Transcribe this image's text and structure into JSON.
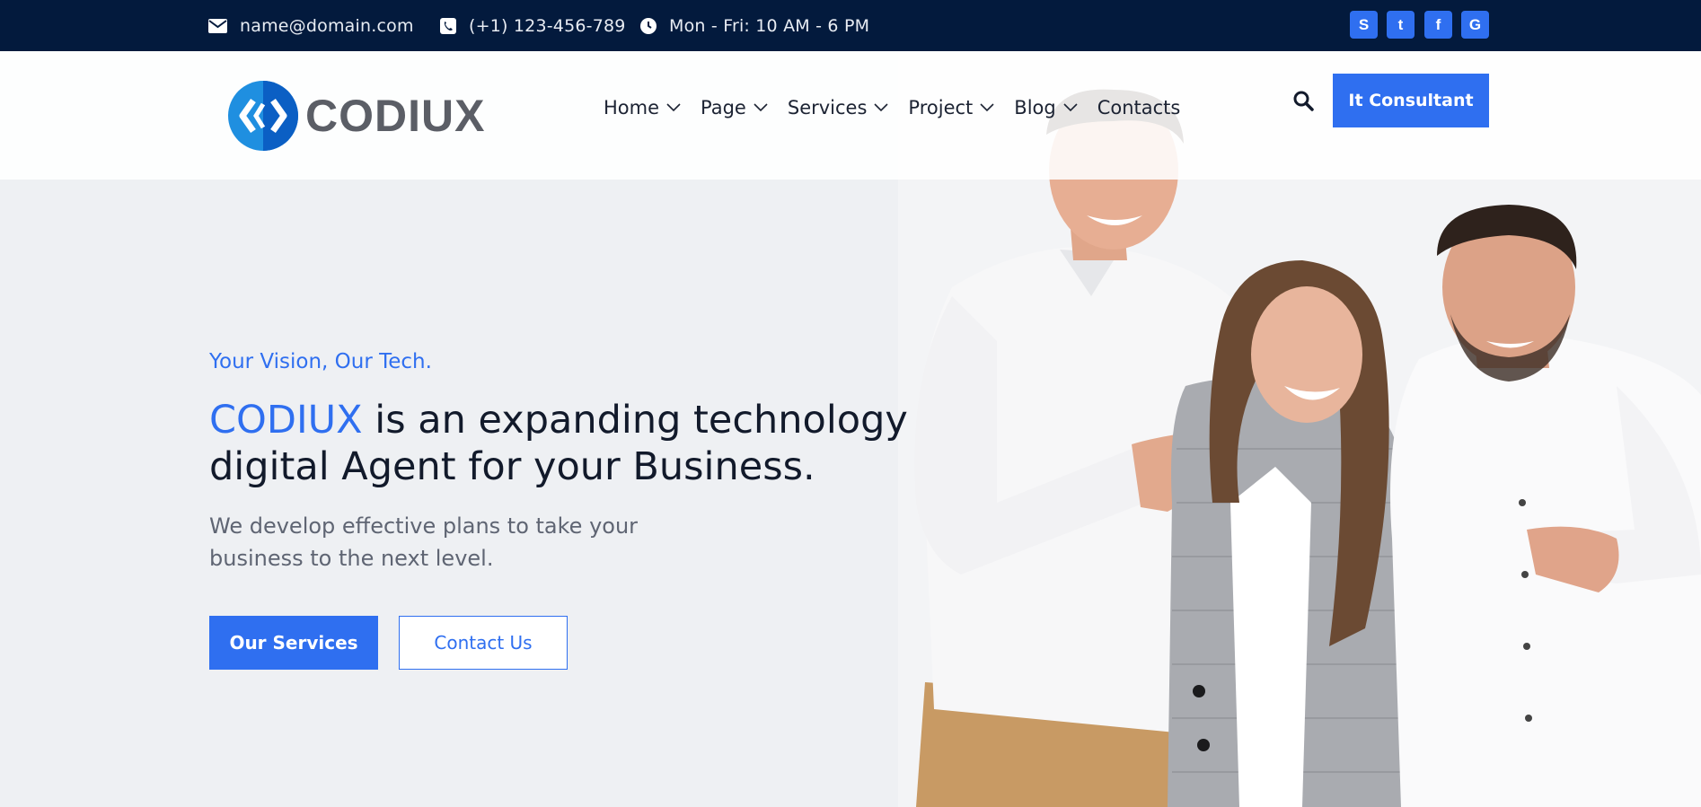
{
  "topbar": {
    "email": "name@domain.com",
    "phone": "(+1) 123-456-789",
    "hours": "Mon - Fri: 10 AM - 6 PM",
    "email_icon": "envelope-icon",
    "phone_icon": "phone-icon",
    "hours_icon": "clock-icon",
    "social": [
      {
        "icon": "skype-icon",
        "glyph": "S"
      },
      {
        "icon": "twitter-icon",
        "glyph": "t"
      },
      {
        "icon": "facebook-icon",
        "glyph": "f"
      },
      {
        "icon": "google-icon",
        "glyph": "G"
      }
    ]
  },
  "header": {
    "logo_text": "CODIUX",
    "nav": [
      {
        "label": "Home",
        "dropdown": true
      },
      {
        "label": "Page",
        "dropdown": true
      },
      {
        "label": "Services",
        "dropdown": true
      },
      {
        "label": "Project",
        "dropdown": true
      },
      {
        "label": "Blog",
        "dropdown": true
      },
      {
        "label": "Contacts",
        "dropdown": false
      }
    ],
    "search_icon": "search-icon",
    "cta_label": "It Consultant"
  },
  "hero": {
    "tagline": "Your Vision, Our Tech.",
    "headline_brand": "CODIUX",
    "headline_rest": " is an expanding technology digital Agent for your Business.",
    "subtext": "We develop effective plans to take your business to the next level.",
    "primary_button": "Our Services",
    "secondary_button": "Contact Us"
  },
  "colors": {
    "accent": "#2f6ff0",
    "topbar_bg": "#031a3d",
    "heading": "#121a2b"
  }
}
